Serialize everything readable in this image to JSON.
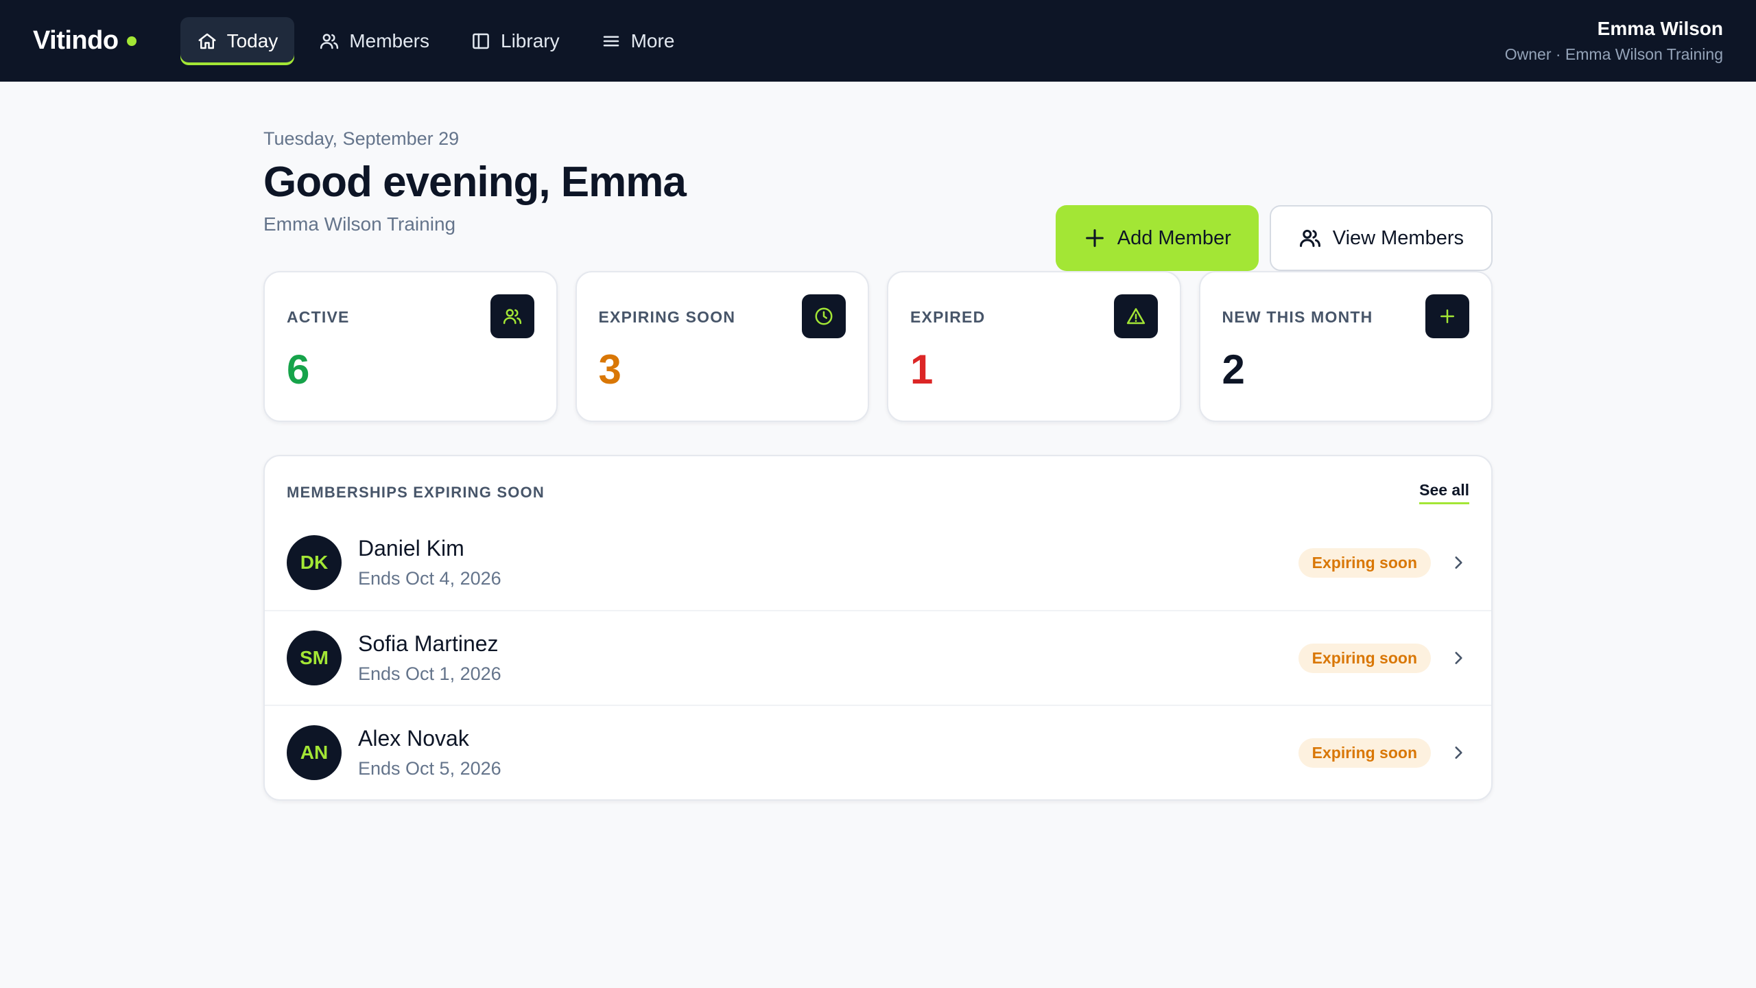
{
  "app": {
    "name": "Vitindo",
    "accent_color": "#a3e635",
    "nav_bg": "#0d1526"
  },
  "nav": {
    "items": [
      {
        "label": "Today",
        "icon": "home-icon",
        "active": true
      },
      {
        "label": "Members",
        "icon": "users-icon",
        "active": false
      },
      {
        "label": "Library",
        "icon": "book-icon",
        "active": false
      },
      {
        "label": "More",
        "icon": "menu-icon",
        "active": false
      }
    ]
  },
  "user": {
    "name": "Emma Wilson",
    "role": "Owner · Emma Wilson Training"
  },
  "header": {
    "date": "Tuesday, September 29",
    "greeting": "Good evening, Emma",
    "org": "Emma Wilson Training"
  },
  "actions": {
    "add_member": "Add Member",
    "view_members": "View Members"
  },
  "stats": [
    {
      "label": "ACTIVE",
      "value": "6",
      "color": "#16a34a",
      "icon": "users-icon"
    },
    {
      "label": "EXPIRING SOON",
      "value": "3",
      "color": "#d97706",
      "icon": "clock-icon"
    },
    {
      "label": "EXPIRED",
      "value": "1",
      "color": "#dc2626",
      "icon": "alert-triangle-icon"
    },
    {
      "label": "NEW THIS MONTH",
      "value": "2",
      "color": "#0d1526",
      "icon": "plus-icon"
    }
  ],
  "expiring": {
    "title": "MEMBERSHIPS EXPIRING SOON",
    "see_all": "See all",
    "members": [
      {
        "initials": "DK",
        "name": "Daniel Kim",
        "ends": "Ends Oct 4, 2026",
        "status": "Expiring soon"
      },
      {
        "initials": "SM",
        "name": "Sofia Martinez",
        "ends": "Ends Oct 1, 2026",
        "status": "Expiring soon"
      },
      {
        "initials": "AN",
        "name": "Alex Novak",
        "ends": "Ends Oct 5, 2026",
        "status": "Expiring soon"
      }
    ]
  }
}
